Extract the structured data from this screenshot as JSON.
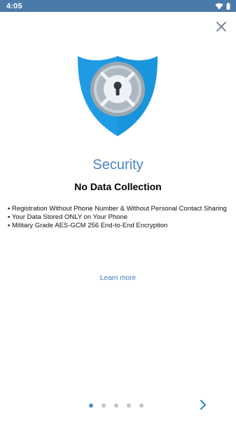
{
  "status_bar": {
    "time": "4:05",
    "icons": [
      "wifi-icon",
      "battery-icon"
    ]
  },
  "close_icon": "close-icon",
  "hero_icon": "security-shield-icon",
  "slide": {
    "title": "Security",
    "subtitle": "No Data Collection",
    "bullets": [
      "▪ Registration Without Phone Number & Without Personal Contact Sharing",
      "▪ Your Data Stored ONLY on Your Phone",
      "▪ Military Grade AES-GCM 256 End-to-End Encryption"
    ],
    "learn_more": "Learn more"
  },
  "pager": {
    "total": 5,
    "current": 1,
    "next_icon": "chevron-right-icon"
  },
  "colors": {
    "status_bar": "#4a7aa8",
    "accent": "#4a86c1",
    "shield": "#1e9be4",
    "dot_active": "#4e8fcc",
    "dot_inactive": "#c4c4c4"
  }
}
